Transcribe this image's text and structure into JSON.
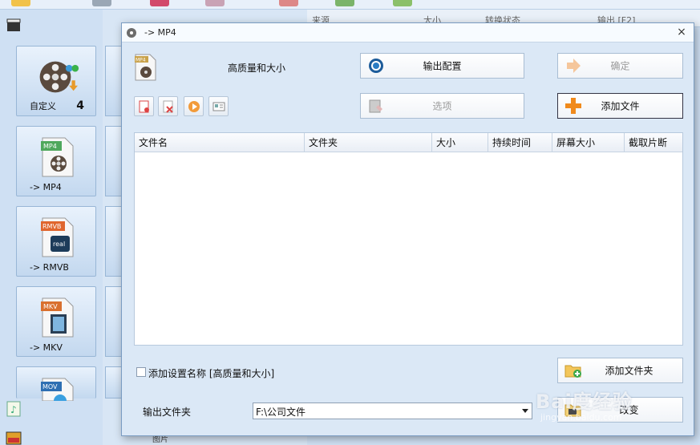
{
  "background": {
    "header_columns": [
      "来源",
      "大小",
      "转换状态",
      "输出 [F2]"
    ],
    "tiles": [
      {
        "label": "自定义",
        "count": "4",
        "icon": "custom-film-users-icon"
      },
      {
        "label": "-> MP4",
        "icon": "mp4-file-icon"
      },
      {
        "label": "-> RMVB",
        "icon": "rmvb-file-icon"
      },
      {
        "label": "-> MKV",
        "icon": "mkv-file-icon"
      },
      {
        "label": "",
        "icon": "mov-file-icon",
        "badge": "MOV"
      }
    ],
    "tile_badges": {
      "mp4": "MP4",
      "rmvb": "RMVB",
      "mkv": "MKV",
      "mov": "MOV"
    },
    "bottom_label": "图片"
  },
  "dialog": {
    "title": "-> MP4",
    "close_glyph": "×",
    "preset_label": "高质量和大小",
    "buttons": {
      "output_config": "输出配置",
      "confirm": "确定",
      "options": "选项",
      "add_file": "添加文件",
      "add_folder": "添加文件夹",
      "change": "改变"
    },
    "table": {
      "columns": [
        "文件名",
        "文件夹",
        "大小",
        "持续时间",
        "屏幕大小",
        "截取片断"
      ],
      "rows": []
    },
    "checkbox": {
      "label": "添加设置名称 [高质量和大小]",
      "checked": false
    },
    "output_folder": {
      "label": "输出文件夹",
      "value": "F:\\公司文件"
    }
  },
  "watermark": {
    "main": "Bai度经验",
    "sub": "jingyan.baidu.com"
  },
  "colors": {
    "accent_orange": "#f08a1c",
    "tile_border": "#98b6d6",
    "dialog_bg": "#dbe8f6"
  }
}
